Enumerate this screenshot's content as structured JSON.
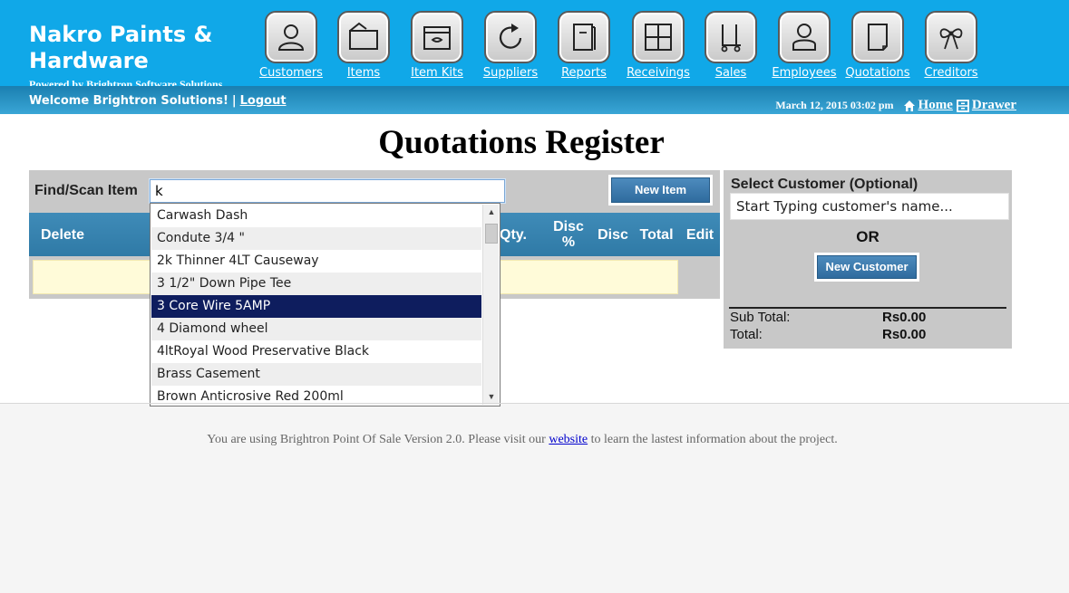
{
  "brand": {
    "name": "Nakro Paints & Hardware",
    "powered_by": "Powered by Brightron Software Solutions"
  },
  "user": {
    "welcome": "Welcome Brightron Solutions!",
    "separator": "|",
    "logout": "Logout"
  },
  "status": {
    "datetime": "March 12, 2015 03:02 pm",
    "home": "Home",
    "drawer": "Drawer"
  },
  "nav": [
    {
      "label": "Customers",
      "icon": "person-icon"
    },
    {
      "label": "Items",
      "icon": "folder-icon"
    },
    {
      "label": "Item Kits",
      "icon": "toolbox-icon"
    },
    {
      "label": "Suppliers",
      "icon": "refresh-arrow-icon"
    },
    {
      "label": "Reports",
      "icon": "book-icon"
    },
    {
      "label": "Receivings",
      "icon": "grid-icon"
    },
    {
      "label": "Sales",
      "icon": "cart-icon"
    },
    {
      "label": "Employees",
      "icon": "user-badge-icon"
    },
    {
      "label": "Quotations",
      "icon": "document-icon"
    },
    {
      "label": "Creditors",
      "icon": "gift-bow-icon"
    }
  ],
  "page": {
    "title": "Quotations Register"
  },
  "register": {
    "find_label": "Find/Scan Item",
    "find_value": "k",
    "new_item": "New Item",
    "columns": [
      "Delete",
      "Qty.",
      "Disc %",
      "Disc",
      "Total",
      "Edit"
    ]
  },
  "autocomplete": {
    "items": [
      "Carwash Dash",
      "Condute 3/4 \"",
      "2k Thinner 4LT Causeway",
      "3 1/2\" Down Pipe Tee",
      "3 Core Wire 5AMP",
      "4 Diamond wheel",
      "4ltRoyal Wood Preservative Black",
      "Brass Casement",
      "Brown Anticrosive Red 200ml"
    ],
    "selected_index": 4
  },
  "customer": {
    "title": "Select Customer (Optional)",
    "placeholder": "Start Typing customer's name...",
    "or": "OR",
    "new_customer": "New Customer",
    "subtotal_label": "Sub Total:",
    "subtotal_value": "Rs0.00",
    "total_label": "Total:",
    "total_value": "Rs0.00"
  },
  "footer": {
    "before": "You are using Brightron Point Of Sale Version 2.0. Please visit our",
    "link": "website",
    "after": "to learn the lastest information about the project."
  }
}
